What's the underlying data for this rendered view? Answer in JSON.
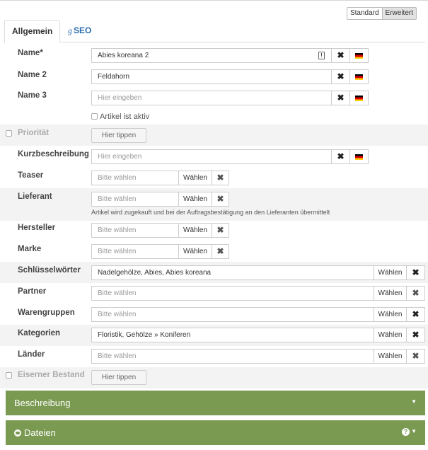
{
  "view_toggle": {
    "standard": "Standard",
    "extended": "Erweitert"
  },
  "tabs": {
    "general": "Allgemein",
    "seo_g": "g",
    "seo": "SEO"
  },
  "fields": {
    "name": {
      "label": "Name*",
      "value": "Abies koreana 2"
    },
    "name2": {
      "label": "Name 2",
      "value": "Feldahorn"
    },
    "name3": {
      "label": "Name 3",
      "placeholder": "Hier eingeben"
    },
    "active": {
      "label": "Artikel ist aktiv"
    },
    "priority": {
      "label": "Priorität",
      "button": "Hier tippen"
    },
    "short_desc": {
      "label": "Kurzbeschreibung",
      "placeholder": "Hier eingeben"
    },
    "teaser": {
      "label": "Teaser",
      "placeholder": "Bitte wählen",
      "button": "Wählen"
    },
    "supplier": {
      "label": "Lieferant",
      "placeholder": "Bitte wählen",
      "button": "Wählen",
      "hint": "Artikel wird zugekauft und bei der Auftragsbestätigung an den Lieferanten übermittelt"
    },
    "manufacturer": {
      "label": "Hersteller",
      "placeholder": "Bitte wählen",
      "button": "Wählen"
    },
    "brand": {
      "label": "Marke",
      "placeholder": "Bitte wählen",
      "button": "Wählen"
    },
    "keywords": {
      "label": "Schlüsselwörter",
      "value": "Nadelgehölze, Abies, Abies koreana",
      "button": "Wählen"
    },
    "partner": {
      "label": "Partner",
      "placeholder": "Bitte wählen",
      "button": "Wählen"
    },
    "product_groups": {
      "label": "Warengruppen",
      "placeholder": "Bitte wählen",
      "button": "Wählen"
    },
    "categories": {
      "label": "Kategorien",
      "value": "Floristik, Gehölze » Koniferen",
      "button": "Wählen"
    },
    "countries": {
      "label": "Länder",
      "placeholder": "Bitte wählen",
      "button": "Wählen"
    },
    "iron_stock": {
      "label": "Eiserner Bestand",
      "button": "Hier tippen"
    }
  },
  "icons": {
    "clear": "✖",
    "info": "!",
    "caret": "▼",
    "help": "?"
  },
  "panels": {
    "description": "Beschreibung",
    "files": "Dateien"
  },
  "colors": {
    "panel_green": "#7a9a52",
    "link_blue": "#2a6fb0"
  }
}
